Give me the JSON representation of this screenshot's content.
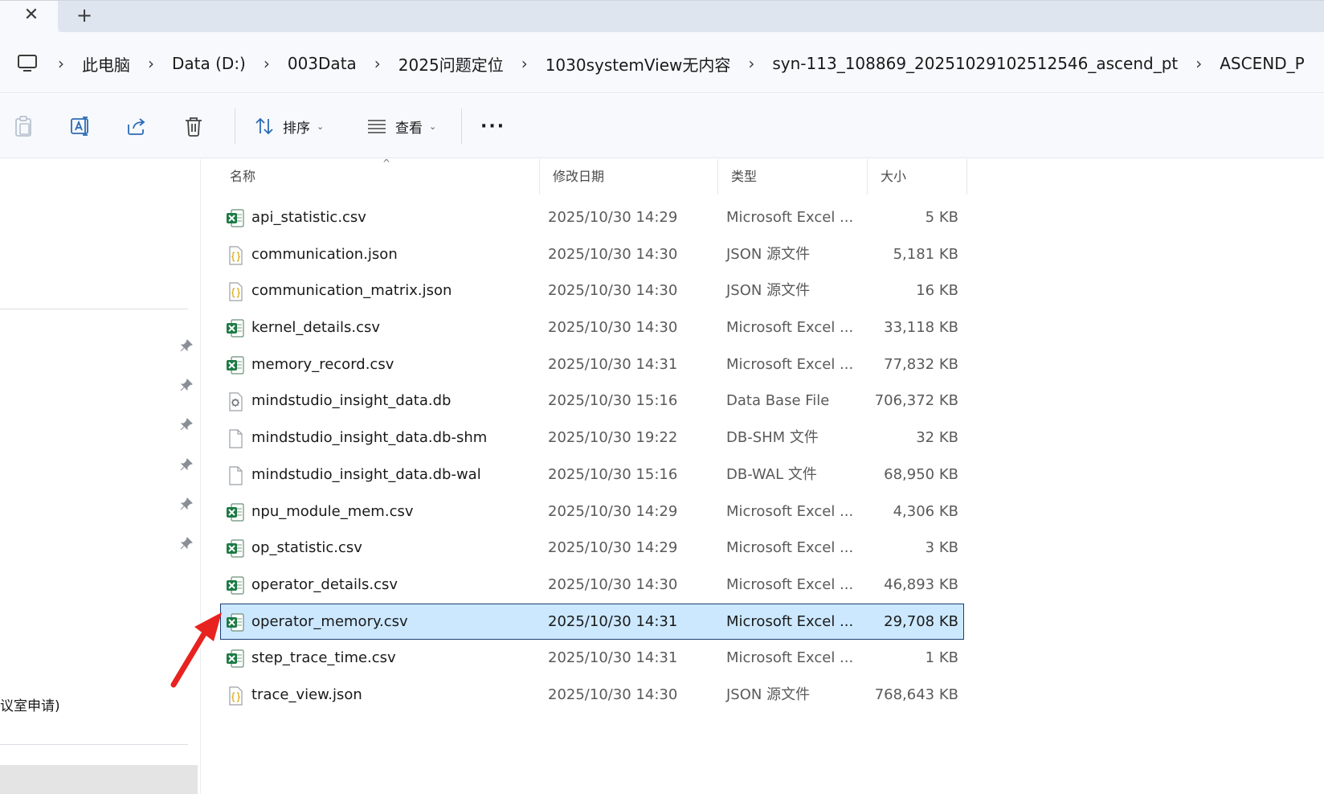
{
  "window": {
    "close_glyph": "✕",
    "new_tab_glyph": "+"
  },
  "address_bar": {
    "icon": "this-pc-icon",
    "separator": "›",
    "crumbs": [
      "此电脑",
      "Data (D:)",
      "003Data",
      "2025问题定位",
      "1030systemView无内容",
      "syn-113_108869_20251029102512546_ascend_pt",
      "ASCEND_P"
    ]
  },
  "toolbar": {
    "paste_icon": "paste-icon",
    "rename_icon": "rename-icon",
    "share_icon": "share-icon",
    "delete_icon": "delete-icon",
    "sort_label": "排序",
    "view_label": "查看",
    "more_label": "···"
  },
  "nav": {
    "partial_text": "议室申请)"
  },
  "columns": {
    "name": "名称",
    "date": "修改日期",
    "type": "类型",
    "size": "大小",
    "sort_indicator": "^"
  },
  "files": [
    {
      "name": "api_statistic.csv",
      "date": "2025/10/30 14:29",
      "type": "Microsoft Excel ...",
      "size": "5 KB",
      "icon": "excel-icon"
    },
    {
      "name": "communication.json",
      "date": "2025/10/30 14:30",
      "type": "JSON 源文件",
      "size": "5,181 KB",
      "icon": "json-icon"
    },
    {
      "name": "communication_matrix.json",
      "date": "2025/10/30 14:30",
      "type": "JSON 源文件",
      "size": "16 KB",
      "icon": "json-icon"
    },
    {
      "name": "kernel_details.csv",
      "date": "2025/10/30 14:30",
      "type": "Microsoft Excel ...",
      "size": "33,118 KB",
      "icon": "excel-icon"
    },
    {
      "name": "memory_record.csv",
      "date": "2025/10/30 14:31",
      "type": "Microsoft Excel ...",
      "size": "77,832 KB",
      "icon": "excel-icon"
    },
    {
      "name": "mindstudio_insight_data.db",
      "date": "2025/10/30 15:16",
      "type": "Data Base File",
      "size": "706,372 KB",
      "icon": "database-file-icon"
    },
    {
      "name": "mindstudio_insight_data.db-shm",
      "date": "2025/10/30 19:22",
      "type": "DB-SHM 文件",
      "size": "32 KB",
      "icon": "blank-file-icon"
    },
    {
      "name": "mindstudio_insight_data.db-wal",
      "date": "2025/10/30 15:16",
      "type": "DB-WAL 文件",
      "size": "68,950 KB",
      "icon": "blank-file-icon"
    },
    {
      "name": "npu_module_mem.csv",
      "date": "2025/10/30 14:29",
      "type": "Microsoft Excel ...",
      "size": "4,306 KB",
      "icon": "excel-icon"
    },
    {
      "name": "op_statistic.csv",
      "date": "2025/10/30 14:29",
      "type": "Microsoft Excel ...",
      "size": "3 KB",
      "icon": "excel-icon"
    },
    {
      "name": "operator_details.csv",
      "date": "2025/10/30 14:30",
      "type": "Microsoft Excel ...",
      "size": "46,893 KB",
      "icon": "excel-icon"
    },
    {
      "name": "operator_memory.csv",
      "date": "2025/10/30 14:31",
      "type": "Microsoft Excel ...",
      "size": "29,708 KB",
      "icon": "excel-icon",
      "selected": true
    },
    {
      "name": "step_trace_time.csv",
      "date": "2025/10/30 14:31",
      "type": "Microsoft Excel ...",
      "size": "1 KB",
      "icon": "excel-icon"
    },
    {
      "name": "trace_view.json",
      "date": "2025/10/30 14:30",
      "type": "JSON 源文件",
      "size": "768,643 KB",
      "icon": "json-icon"
    }
  ],
  "colors": {
    "selection_bg": "#cce8ff",
    "selection_border": "#1b3e73",
    "excel_green": "#1d7a45",
    "annotation_arrow": "#e8231f"
  },
  "annotation": {
    "icon": "red-arrow-annotation"
  }
}
